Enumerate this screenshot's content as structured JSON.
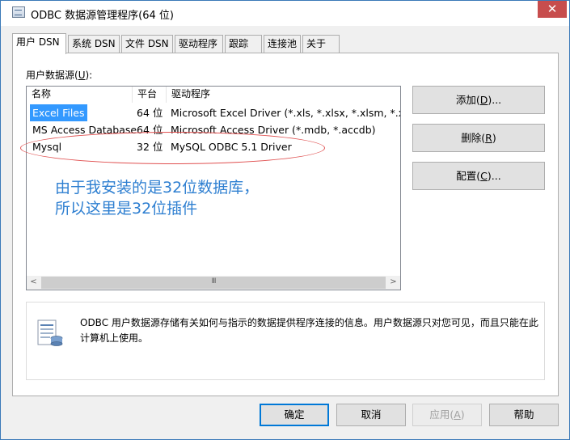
{
  "window": {
    "title": "ODBC 数据源管理程序(64 位)",
    "close_glyph": "✕"
  },
  "tabs": [
    {
      "label": "用户 DSN",
      "active": true
    },
    {
      "label": "系统 DSN"
    },
    {
      "label": "文件 DSN"
    },
    {
      "label": "驱动程序"
    },
    {
      "label": "跟踪"
    },
    {
      "label": "连接池"
    },
    {
      "label": "关于"
    }
  ],
  "user_dsn": {
    "group_label_prefix": "用户数据源(",
    "group_label_key": "U",
    "group_label_suffix": "):",
    "columns": [
      "名称",
      "平台",
      "驱动程序"
    ],
    "rows": [
      {
        "name": "Excel Files",
        "platform": "64 位",
        "driver": "Microsoft Excel Driver (*.xls, *.xlsx, *.xlsm, *.xlsb)",
        "selected": true
      },
      {
        "name": "MS Access Database",
        "platform": "64 位",
        "driver": "Microsoft Access Driver (*.mdb, *.accdb)"
      },
      {
        "name": "Mysql",
        "platform": "32 位",
        "driver": "MySQL ODBC 5.1 Driver"
      }
    ],
    "scroll": {
      "left": "<",
      "right": ">",
      "thumb": "III"
    }
  },
  "side_buttons": {
    "add": {
      "prefix": "添加(",
      "key": "D",
      "suffix": ")..."
    },
    "remove": {
      "prefix": "删除(",
      "key": "R",
      "suffix": ")"
    },
    "configure": {
      "prefix": "配置(",
      "key": "C",
      "suffix": ")..."
    }
  },
  "annotation": {
    "line1": "由于我安装的是32位数据库，",
    "line2": "所以这里是32位插件",
    "color": "#2e7fd1"
  },
  "info": {
    "text": "ODBC 用户数据源存储有关如何与指示的数据提供程序连接的信息。用户数据源只对您可见，而且只能在此计算机上使用。",
    "icon": "data-source-icon"
  },
  "footer": {
    "ok": "确定",
    "cancel": "取消",
    "apply_prefix": "应用(",
    "apply_key": "A",
    "apply_suffix": ")",
    "help": "帮助"
  },
  "colors": {
    "selection": "#3399ff",
    "close_button": "#c74d4d",
    "ellipse": "#e05050"
  }
}
